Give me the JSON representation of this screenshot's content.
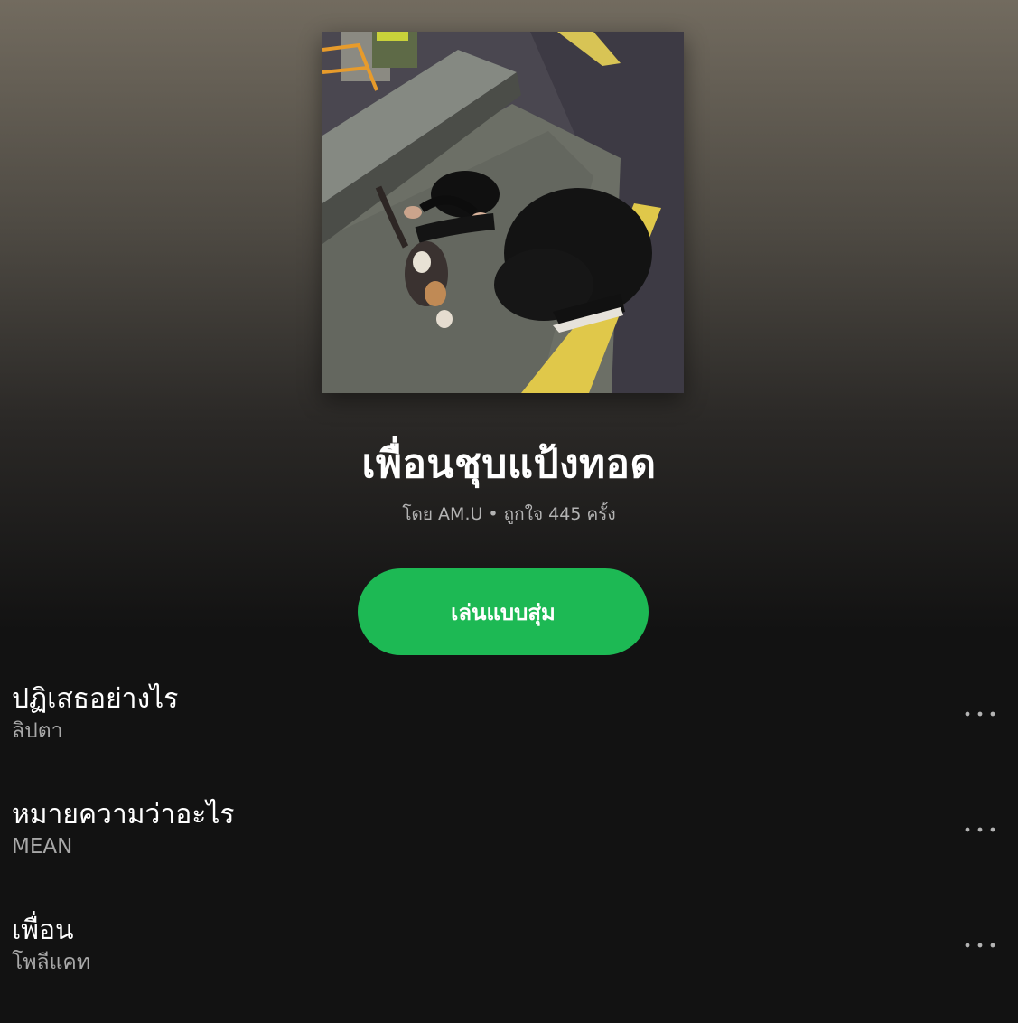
{
  "playlist": {
    "title": "เพื่อนชุบแป้งทอด",
    "meta": "โดย AM.U • ถูกใจ 445 ครั้ง",
    "shuffle_label": "เล่นแบบสุ่ม"
  },
  "tracks": [
    {
      "title": "ปฏิเสธอย่างไร",
      "artist": "ลิปตา"
    },
    {
      "title": "หมายความว่าอะไร",
      "artist": "MEAN"
    },
    {
      "title": "เพื่อน",
      "artist": "โพลีแคท"
    }
  ],
  "icons": {
    "more": "more-horizontal-icon"
  },
  "colors": {
    "accent": "#1db954",
    "background": "#121212",
    "header_gradient_top": "#726b5f",
    "secondary_text": "#b3b3b3"
  }
}
